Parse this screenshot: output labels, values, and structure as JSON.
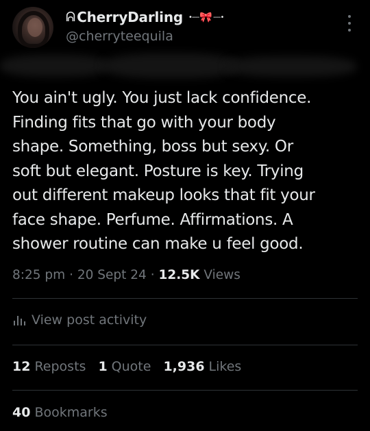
{
  "user": {
    "display_name": "CherryDarling",
    "name_prefix_glyph": "ᕱ",
    "handle": "@cherryteequila",
    "avatar": "profile-photo"
  },
  "tweet": {
    "lines": [
      "You ain't ugly. You just lack confidence.",
      "Finding fits that go with your body",
      "shape. Something, boss but sexy. Or",
      "soft but elegant. Posture is key. Trying",
      "out different makeup looks that fit your",
      "face shape. Perfume. Affirmations. A",
      "shower routine can make u feel good."
    ],
    "time": "8:25 pm",
    "date": "20 Sept 24",
    "views_count": "12.5K",
    "views_label": "Views"
  },
  "activity": {
    "label": "View post activity",
    "icon": "bar-chart-icon"
  },
  "stats": {
    "reposts_count": "12",
    "reposts_label": "Reposts",
    "quotes_count": "1",
    "quotes_label": "Quote",
    "likes_count": "1,936",
    "likes_label": "Likes",
    "bookmarks_count": "40",
    "bookmarks_label": "Bookmarks"
  },
  "colors": {
    "background": "#000000",
    "primary_text": "#e7e9ea",
    "secondary_text": "#71767b",
    "divider": "#2f3336",
    "bow_accent": "#ffb3c6"
  },
  "icons": {
    "more": "more-vertical-icon",
    "bow": "bow-icon"
  }
}
